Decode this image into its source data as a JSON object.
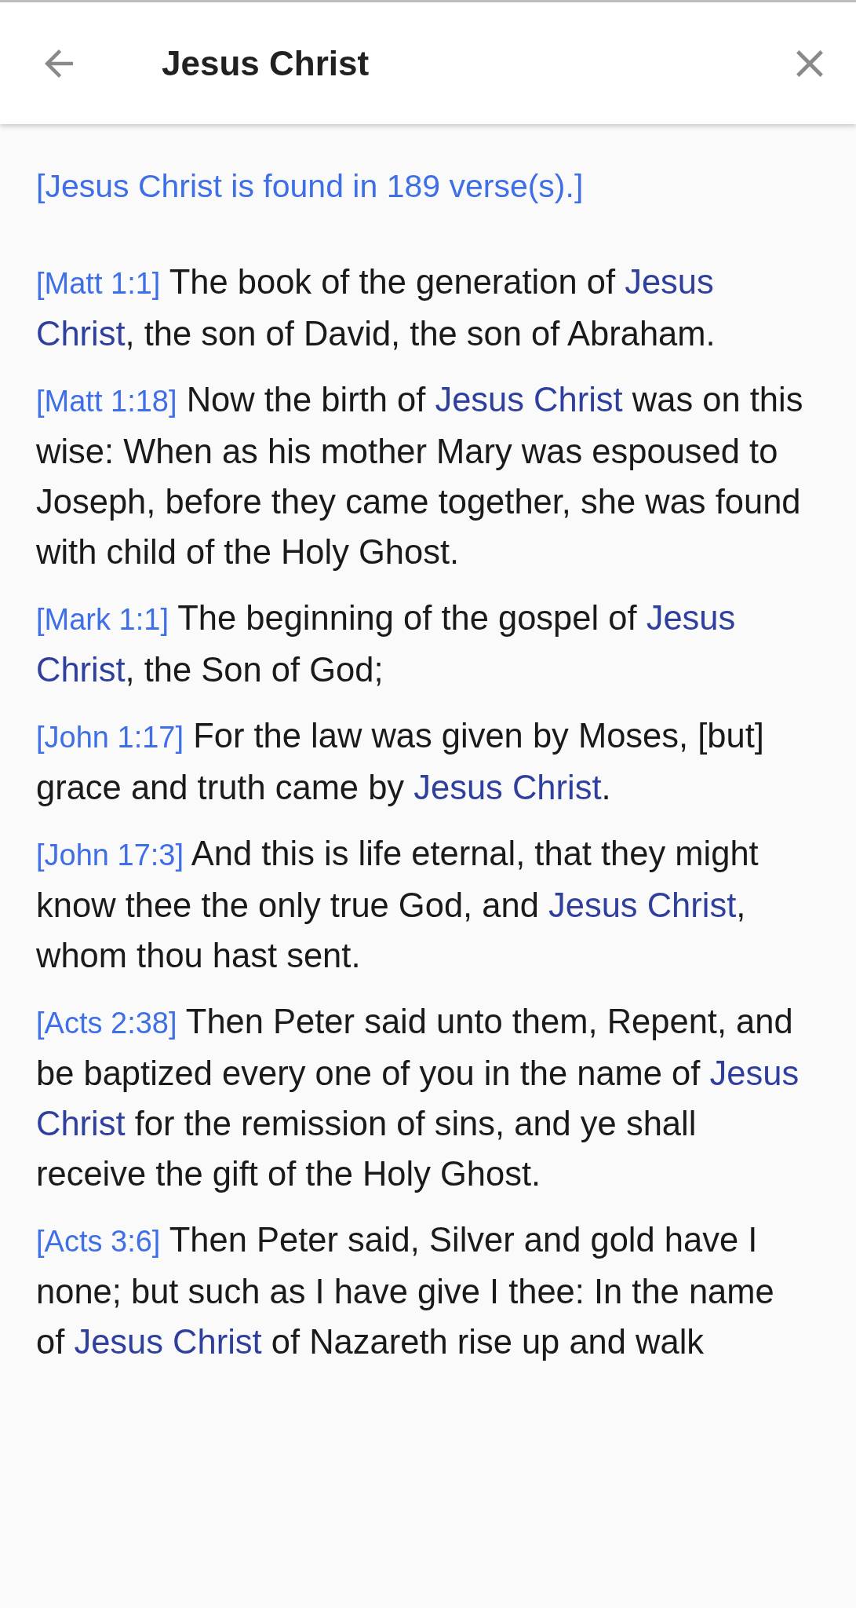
{
  "app_bar": {
    "title": "Jesus Christ"
  },
  "summary": "[Jesus Christ is found in 189 verse(s).]",
  "verses": [
    {
      "reference": "[Matt 1:1]",
      "segments": [
        {
          "text": " The book of the generation of ",
          "highlight": false
        },
        {
          "text": "Jesus Christ",
          "highlight": true
        },
        {
          "text": ", the son of David, the son of Abraham.",
          "highlight": false
        }
      ]
    },
    {
      "reference": "[Matt 1:18]",
      "segments": [
        {
          "text": " Now the birth of ",
          "highlight": false
        },
        {
          "text": "Jesus Christ",
          "highlight": true
        },
        {
          "text": " was on this wise: When as his mother Mary was espoused to Joseph, before they came together, she was found with child of the Holy Ghost.",
          "highlight": false
        }
      ]
    },
    {
      "reference": "[Mark 1:1]",
      "segments": [
        {
          "text": " The beginning of the gospel of ",
          "highlight": false
        },
        {
          "text": "Jesus Christ",
          "highlight": true
        },
        {
          "text": ", the Son of God;",
          "highlight": false
        }
      ]
    },
    {
      "reference": "[John 1:17]",
      "segments": [
        {
          "text": " For the law was given by Moses, [but] grace and truth came by ",
          "highlight": false
        },
        {
          "text": "Jesus Christ",
          "highlight": true
        },
        {
          "text": ".",
          "highlight": false
        }
      ]
    },
    {
      "reference": "[John 17:3]",
      "segments": [
        {
          "text": " And this is life eternal, that they might know thee the only true God, and ",
          "highlight": false
        },
        {
          "text": "Jesus Christ",
          "highlight": true
        },
        {
          "text": ", whom thou hast sent.",
          "highlight": false
        }
      ]
    },
    {
      "reference": "[Acts 2:38]",
      "segments": [
        {
          "text": " Then Peter said unto them, Repent, and be baptized every one of you in the name of ",
          "highlight": false
        },
        {
          "text": "Jesus Christ",
          "highlight": true
        },
        {
          "text": " for the remission of sins, and ye shall receive the gift of the Holy Ghost.",
          "highlight": false
        }
      ]
    },
    {
      "reference": "[Acts 3:6]",
      "segments": [
        {
          "text": " Then Peter said, Silver and gold have I none; but such as I have give I thee: In the name of ",
          "highlight": false
        },
        {
          "text": "Jesus Christ",
          "highlight": true
        },
        {
          "text": " of Nazareth rise up and walk",
          "highlight": false
        }
      ]
    }
  ]
}
